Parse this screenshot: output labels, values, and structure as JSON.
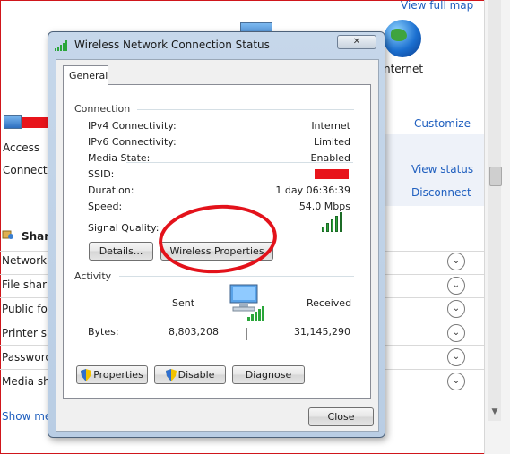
{
  "background_window": {
    "top_link": "View full map",
    "internet_label": "nternet",
    "customize_link": "Customize",
    "access_label": "Access",
    "connections_label": "Connectio",
    "view_status_link": "View status",
    "disconnect_link": "Disconnect",
    "sharing_heading": "Shari",
    "items": [
      "Network c",
      "File sharin",
      "Public fol",
      "Printer sh",
      "Password",
      "Media sha"
    ],
    "show_more_link": "Show me"
  },
  "dialog": {
    "title": "Wireless Network Connection Status",
    "close_glyph": "✕",
    "tab_general": "General",
    "connection": {
      "heading": "Connection",
      "rows": [
        {
          "label": "IPv4 Connectivity:",
          "value": "Internet"
        },
        {
          "label": "IPv6 Connectivity:",
          "value": "Limited"
        },
        {
          "label": "Media State:",
          "value": "Enabled"
        },
        {
          "label": "SSID:",
          "value": ""
        },
        {
          "label": "Duration:",
          "value": "1 day 06:36:39"
        },
        {
          "label": "Speed:",
          "value": "54.0 Mbps"
        }
      ],
      "signal_label": "Signal Quality:",
      "signal_level_bars": 5,
      "details_button": "Details...",
      "wireless_properties_button": "Wireless Properties"
    },
    "activity": {
      "heading": "Activity",
      "sent_label": "Sent",
      "received_label": "Received",
      "bytes_label": "Bytes:",
      "bytes_sent": "8,803,208",
      "bytes_received": "31,145,290"
    },
    "buttons": {
      "properties": "Properties",
      "disable": "Disable",
      "diagnose": "Diagnose",
      "close": "Close"
    }
  },
  "colors": {
    "redaction": "#e8141b",
    "annotation_circle": "#e3121b",
    "link": "#1f5fbf",
    "signal_bars": "#2aa63a"
  }
}
